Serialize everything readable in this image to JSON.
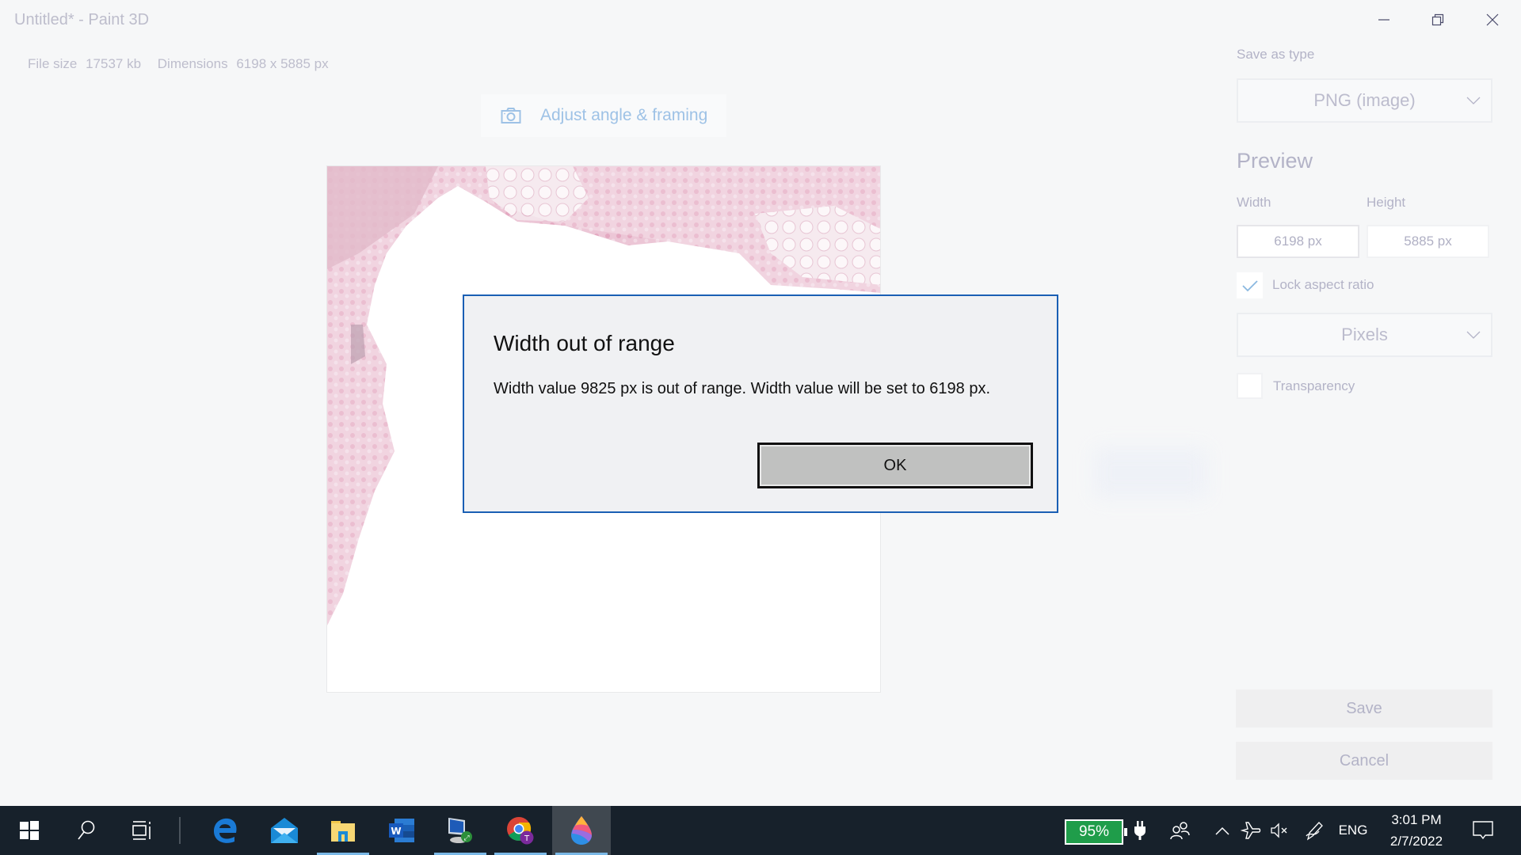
{
  "window": {
    "title": "Untitled* - Paint 3D",
    "controls": [
      "minimize",
      "restore",
      "close"
    ]
  },
  "file_info": {
    "file_size_label": "File size",
    "file_size_value": "17537 kb",
    "dimensions_label": "Dimensions",
    "dimensions_value": "6198 x 5885 px"
  },
  "toolbar": {
    "adjust_label": "Adjust angle & framing",
    "adjust_icon": "camera-icon"
  },
  "panel": {
    "save_as_type_label": "Save as type",
    "save_as_type_value": "PNG (image)",
    "preview_heading": "Preview",
    "width_label": "Width",
    "height_label": "Height",
    "width_value": "6198 px",
    "height_value": "5885 px",
    "lock_aspect_label": "Lock aspect ratio",
    "lock_aspect_checked": true,
    "units_value": "Pixels",
    "transparency_label": "Transparency",
    "transparency_checked": false,
    "save_label": "Save",
    "cancel_label": "Cancel"
  },
  "dialog": {
    "title": "Width out of range",
    "message": "Width value 9825 px is out of range. Width value will be set to 6198 px.",
    "ok_label": "OK",
    "border_color": "#1a5fb4"
  },
  "taskbar": {
    "apps": [
      {
        "name": "start",
        "icon": "windows-icon"
      },
      {
        "name": "search",
        "icon": "search-icon"
      },
      {
        "name": "task-view",
        "icon": "task-view-icon"
      },
      {
        "name": "edge",
        "icon": "edge-icon"
      },
      {
        "name": "mail",
        "icon": "mail-icon",
        "running": true
      },
      {
        "name": "file-explorer",
        "icon": "folder-icon",
        "running": true
      },
      {
        "name": "word",
        "icon": "word-icon"
      },
      {
        "name": "remote-desktop",
        "icon": "remote-desktop-icon",
        "running": true
      },
      {
        "name": "chrome",
        "icon": "chrome-icon",
        "running": true
      },
      {
        "name": "paint-3d",
        "icon": "paint3d-icon",
        "running": true,
        "active": true
      }
    ],
    "battery": "95%",
    "battery_color": "#1f9d4a",
    "language": "ENG",
    "time": "3:01 PM",
    "date": "2/7/2022"
  }
}
